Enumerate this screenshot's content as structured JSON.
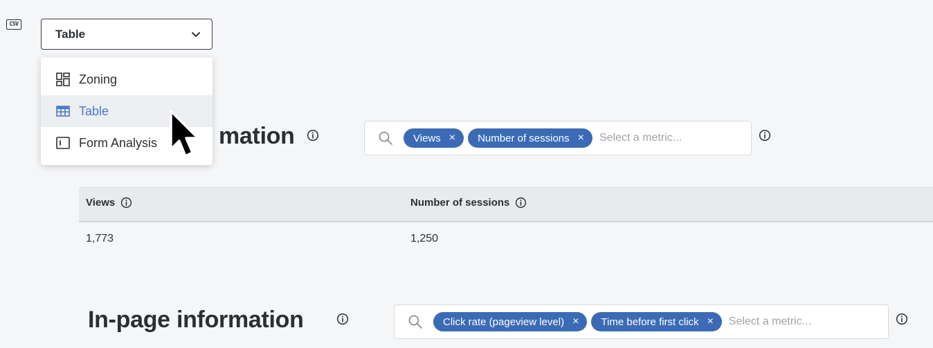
{
  "toolbar": {
    "csv_label": "CSV",
    "view_select": {
      "value": "Table"
    }
  },
  "menu": {
    "items": [
      {
        "label": "Zoning",
        "icon": "zoning-icon",
        "selected": false
      },
      {
        "label": "Table",
        "icon": "table-icon",
        "selected": true
      },
      {
        "label": "Form Analysis",
        "icon": "form-analysis-icon",
        "selected": false
      }
    ]
  },
  "section1": {
    "title_visible": "mation",
    "picker": {
      "chips": [
        "Views",
        "Number of sessions"
      ],
      "placeholder": "Select a metric..."
    },
    "table": {
      "columns": [
        "Views",
        "Number of sessions"
      ],
      "rows": [
        [
          "1,773",
          "1,250"
        ]
      ]
    }
  },
  "section2": {
    "title": "In-page information",
    "picker": {
      "chips": [
        "Click rate (pageview level)",
        "Time before first click"
      ],
      "placeholder": "Select a metric..."
    }
  },
  "colors": {
    "chip": "#3b6bb5",
    "accent": "#4a79c8",
    "background": "#f5f6f8"
  }
}
